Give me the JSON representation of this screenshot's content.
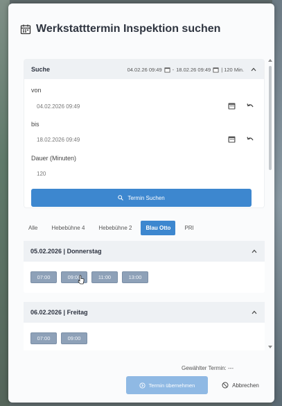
{
  "dialog": {
    "title": "Werkstatttermin Inspektion suchen"
  },
  "search": {
    "label": "Suche",
    "summary_from": "04.02.26 09:49",
    "summary_sep": "-",
    "summary_to": "18.02.26 09:49",
    "summary_duration": "| 120 Min.",
    "from_label": "von",
    "from_value": "04.02.2026 09:49",
    "to_label": "bis",
    "to_value": "18.02.2026 09:49",
    "duration_label": "Dauer (Minuten)",
    "duration_value": "120",
    "button_label": "Termin Suchen"
  },
  "tabs": [
    "Alle",
    "Hebebühne 4",
    "Hebebühne 2",
    "Blau Otto",
    "PRI"
  ],
  "active_tab": "Blau Otto",
  "days": [
    {
      "header": "05.02.2026 | Donnerstag",
      "slots": [
        "07:00",
        "09:00",
        "11:00",
        "13:00"
      ]
    },
    {
      "header": "06.02.2026 | Freitag",
      "slots": [
        "07:00",
        "09:00"
      ]
    }
  ],
  "footer": {
    "selected_label": "Gewählter Termin:",
    "selected_value": "---",
    "confirm_label": "Termin übernehmen",
    "cancel_label": "Abbrechen"
  },
  "colors": {
    "primary": "#3d87cf",
    "primary_disabled": "#8fb9e4",
    "slot": "#8ea1b8",
    "header_bg": "#eef1f4"
  }
}
